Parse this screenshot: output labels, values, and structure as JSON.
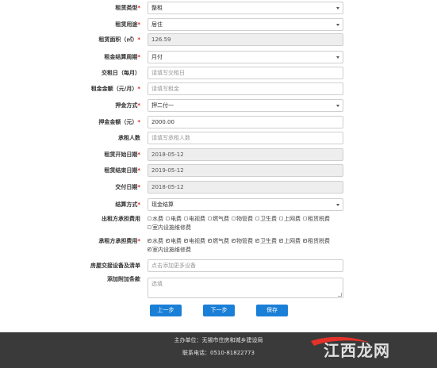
{
  "form": {
    "rental_type": {
      "label": "租赁类型",
      "value": "整租"
    },
    "rental_use": {
      "label": "租赁用途",
      "value": "居住"
    },
    "rental_area": {
      "label": "租赁面积（㎡）",
      "value": "126.59"
    },
    "payment_cycle": {
      "label": "租金结算周期",
      "value": "月付"
    },
    "rent_day": {
      "label": "交租日（每月）",
      "placeholder": "请填写交租日"
    },
    "rent_amount": {
      "label": "租金金额（元/月）",
      "placeholder": "请填写租金"
    },
    "deposit_method": {
      "label": "押金方式",
      "value": "押二付一"
    },
    "deposit_amount": {
      "label": "押金金额（元）",
      "value": "2000.00"
    },
    "tenant_count": {
      "label": "承租人数",
      "placeholder": "请填写承租人数"
    },
    "lease_start": {
      "label": "租赁开始日期",
      "value": "2018-05-12"
    },
    "lease_end": {
      "label": "租赁结束日期",
      "value": "2019-05-12"
    },
    "delivery_date": {
      "label": "交付日期",
      "value": "2018-05-12"
    },
    "settlement_method": {
      "label": "结算方式",
      "value": "现金结算"
    },
    "lessor_fees": {
      "label": "出租方承担费用",
      "options": [
        {
          "label": "水费",
          "checked": false
        },
        {
          "label": "电费",
          "checked": false
        },
        {
          "label": "电视费",
          "checked": false
        },
        {
          "label": "燃气费",
          "checked": false
        },
        {
          "label": "物管费",
          "checked": false
        },
        {
          "label": "卫生费",
          "checked": false
        },
        {
          "label": "上网费",
          "checked": false
        },
        {
          "label": "租赁税费",
          "checked": false
        },
        {
          "label": "室内设施维修费",
          "checked": false
        }
      ]
    },
    "lessee_fees": {
      "label": "承租方承担费用",
      "options": [
        {
          "label": "水费",
          "checked": true
        },
        {
          "label": "电费",
          "checked": true
        },
        {
          "label": "电视费",
          "checked": true
        },
        {
          "label": "燃气费",
          "checked": true
        },
        {
          "label": "物管费",
          "checked": true
        },
        {
          "label": "卫生费",
          "checked": true
        },
        {
          "label": "上网费",
          "checked": true
        },
        {
          "label": "租赁税费",
          "checked": true
        },
        {
          "label": "室内设施维修费",
          "checked": true
        }
      ]
    },
    "equipment_list": {
      "label": "房屋交接设备及清单",
      "placeholder": "点击添加更多设备"
    },
    "additional_terms": {
      "label": "添加附加条款",
      "placeholder": "选填"
    }
  },
  "buttons": {
    "prev": "上一步",
    "next": "下一步",
    "save": "保存"
  },
  "footer": {
    "organizer": "主办单位：无锡市住房和城乡建设局",
    "phone": "联系电话：0510-81822773"
  },
  "watermark": {
    "text": "江西龙网"
  },
  "colors": {
    "primary_button": "#1a7fd6",
    "required_star": "#d9231c",
    "footer_bg": "#3a3a3a"
  }
}
